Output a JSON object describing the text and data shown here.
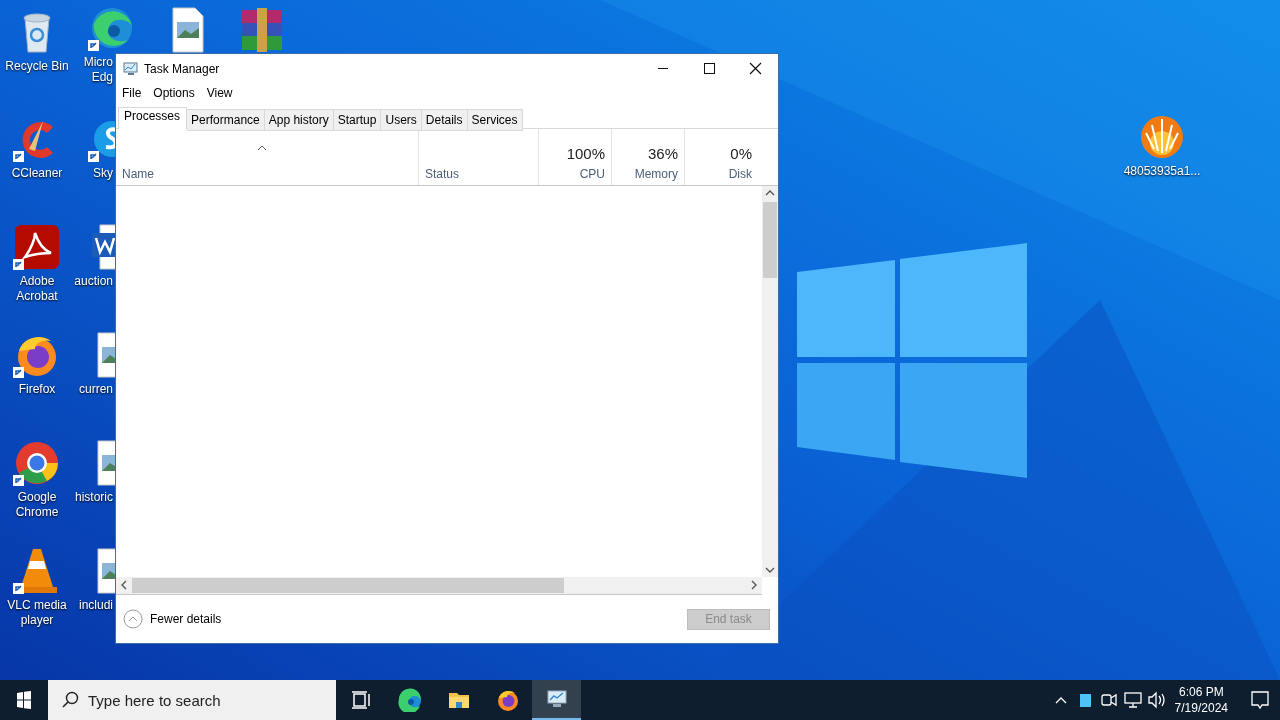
{
  "desktop": {
    "icons": [
      {
        "kind": "recycle-bin",
        "lines": [
          "Recycle Bin"
        ],
        "shortcut": false
      },
      {
        "kind": "ccleaner",
        "lines": [
          "CCleaner"
        ],
        "shortcut": true
      },
      {
        "kind": "acrobat",
        "lines": [
          "Adobe",
          "Acrobat"
        ],
        "shortcut": true
      },
      {
        "kind": "firefox",
        "lines": [
          "Firefox"
        ],
        "shortcut": true
      },
      {
        "kind": "chrome",
        "lines": [
          "Google",
          "Chrome"
        ],
        "shortcut": true
      },
      {
        "kind": "vlc",
        "lines": [
          "VLC media",
          "player"
        ],
        "shortcut": true
      },
      {
        "kind": "edge",
        "lines": [
          "Micro",
          "Edg"
        ],
        "shortcut": true
      },
      {
        "kind": "skype",
        "lines": [
          "Sky"
        ],
        "shortcut": true
      },
      {
        "kind": "word",
        "lines": [
          "auction"
        ],
        "shortcut": false
      },
      {
        "kind": "image-file",
        "lines": [
          "curren"
        ],
        "shortcut": false
      },
      {
        "kind": "image-file",
        "lines": [
          "historic"
        ],
        "shortcut": false
      },
      {
        "kind": "image-file",
        "lines": [
          "includi"
        ],
        "shortcut": false
      },
      {
        "kind": "image-file",
        "shortcut": false
      },
      {
        "kind": "archive",
        "shortcut": false
      },
      {
        "kind": "bittorrent",
        "lines": [
          "48053935a1..."
        ],
        "shortcut": false
      }
    ]
  },
  "window": {
    "title": "Task Manager",
    "menu": [
      "File",
      "Options",
      "View"
    ],
    "tabs": [
      {
        "label": "Processes",
        "selected": true
      },
      {
        "label": "Performance",
        "selected": false
      },
      {
        "label": "App history",
        "selected": false
      },
      {
        "label": "Startup",
        "selected": false
      },
      {
        "label": "Users",
        "selected": false
      },
      {
        "label": "Details",
        "selected": false
      },
      {
        "label": "Services",
        "selected": false
      }
    ],
    "columns": [
      {
        "label": "Name",
        "sorted": true
      },
      {
        "label": "Status",
        "sorted": false
      },
      {
        "label": "CPU",
        "value": "100%",
        "sorted": false
      },
      {
        "label": "Memory",
        "value": "36%",
        "sorted": false
      },
      {
        "label": "Disk",
        "value": "0%",
        "sorted": false
      }
    ],
    "footer": {
      "toggle": "Fewer details",
      "button": {
        "label": "End task",
        "disabled": true
      }
    }
  },
  "taskbar": {
    "search": {
      "placeholder": "Type here to search"
    },
    "apps": [
      {
        "kind": "task-view",
        "active": false
      },
      {
        "kind": "edge",
        "active": false
      },
      {
        "kind": "folder",
        "active": false
      },
      {
        "kind": "firefox",
        "active": false
      },
      {
        "kind": "task-manager",
        "active": true
      }
    ],
    "clock": {
      "time": "6:06 PM",
      "date": "7/19/2024"
    }
  }
}
